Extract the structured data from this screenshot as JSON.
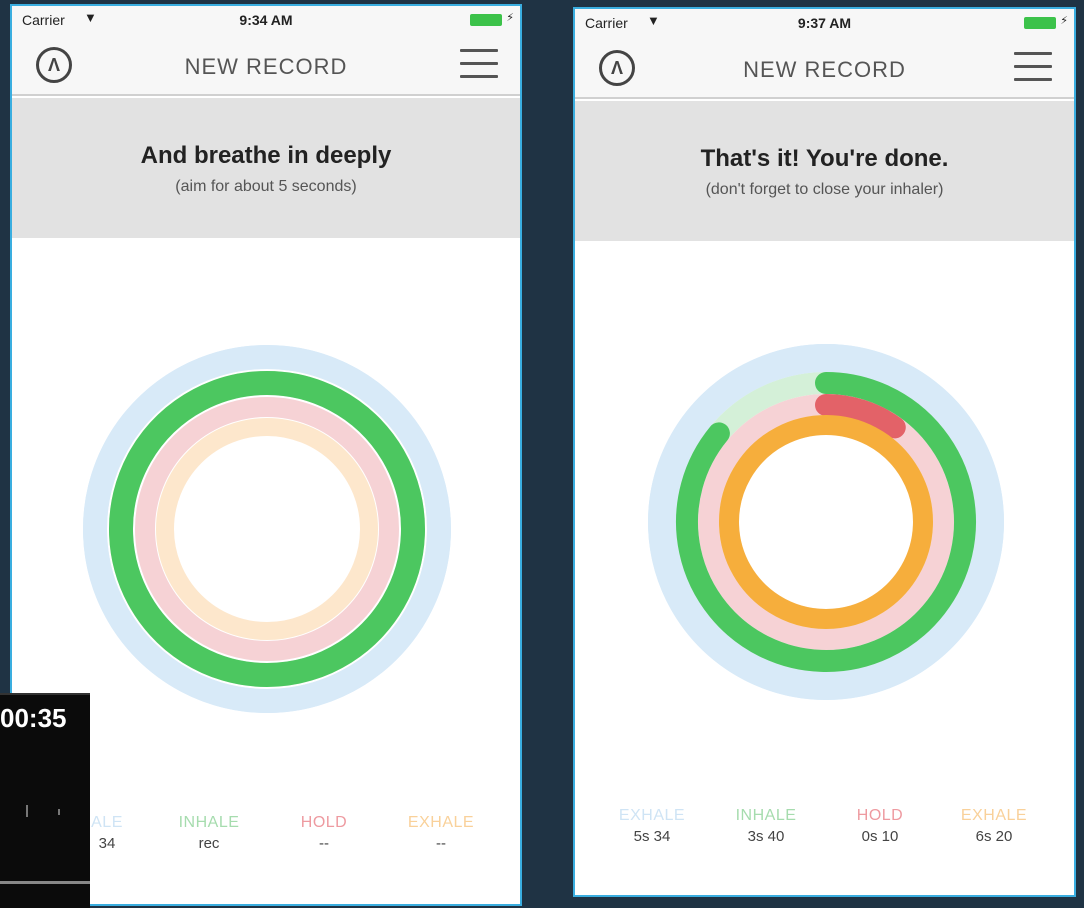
{
  "colors": {
    "exhale_first": "#d8eaf8",
    "inhale": "#4cc760",
    "hold": "#e36268",
    "exhale": "#f6ae3c"
  },
  "left_screen": {
    "status": {
      "carrier": "Carrier",
      "time": "9:34 AM"
    },
    "nav": {
      "title": "NEW RECORD"
    },
    "banner": {
      "headline": "And breathe in deeply",
      "subline": "(aim for about 5 seconds)"
    },
    "rings": {
      "exhale_first": 1.0,
      "inhale": 1.0,
      "hold": 0.0,
      "exhale": 0.0
    },
    "stats": [
      {
        "label": "ALE",
        "value": "34"
      },
      {
        "label": "INHALE",
        "value": "rec"
      },
      {
        "label": "HOLD",
        "value": "--"
      },
      {
        "label": "EXHALE",
        "value": "--"
      }
    ]
  },
  "right_screen": {
    "status": {
      "carrier": "Carrier",
      "time": "9:37 AM"
    },
    "nav": {
      "title": "NEW RECORD"
    },
    "banner": {
      "headline": "That's it! You're done.",
      "subline": "(don't forget to close your inhaler)"
    },
    "rings": {
      "exhale_first": 1.0,
      "inhale": 0.86,
      "hold": 0.1,
      "exhale": 1.0
    },
    "stats": [
      {
        "label": "EXHALE",
        "value": "5s 34"
      },
      {
        "label": "INHALE",
        "value": "3s 40"
      },
      {
        "label": "HOLD",
        "value": "0s 10"
      },
      {
        "label": "EXHALE",
        "value": "6s 20"
      }
    ]
  },
  "overlay": {
    "timer": "00:35"
  }
}
